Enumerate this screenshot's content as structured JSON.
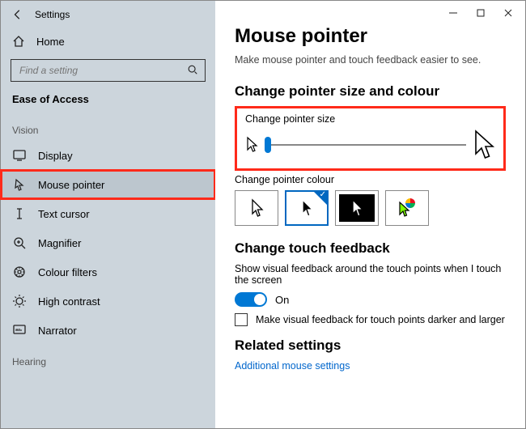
{
  "window": {
    "title": "Settings",
    "home": "Home",
    "search_placeholder": "Find a setting",
    "section": "Ease of Access",
    "group_vision": "Vision",
    "group_hearing": "Hearing",
    "items": [
      {
        "label": "Display",
        "icon": "display-icon"
      },
      {
        "label": "Mouse pointer",
        "icon": "mouse-pointer-icon"
      },
      {
        "label": "Text cursor",
        "icon": "text-cursor-icon"
      },
      {
        "label": "Magnifier",
        "icon": "magnifier-icon"
      },
      {
        "label": "Colour filters",
        "icon": "colour-filters-icon"
      },
      {
        "label": "High contrast",
        "icon": "high-contrast-icon"
      },
      {
        "label": "Narrator",
        "icon": "narrator-icon"
      }
    ]
  },
  "main": {
    "heading": "Mouse pointer",
    "subtitle": "Make mouse pointer and touch feedback easier to see.",
    "section_size_colour": "Change pointer size and colour",
    "label_size": "Change pointer size",
    "label_colour": "Change pointer colour",
    "section_touch": "Change touch feedback",
    "touch_desc": "Show visual feedback around the touch points when I touch the screen",
    "toggle_label": "On",
    "checkbox_label": "Make visual feedback for touch points darker and larger",
    "section_related": "Related settings",
    "related_link": "Additional mouse settings",
    "colour_options": [
      "white",
      "black",
      "inverted",
      "custom"
    ]
  }
}
